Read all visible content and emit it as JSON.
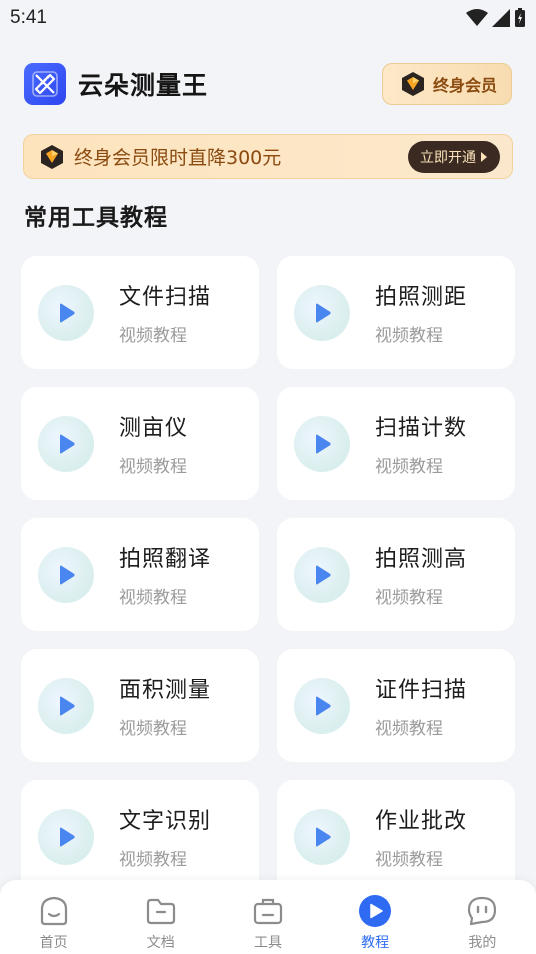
{
  "status_bar": {
    "time": "5:41"
  },
  "header": {
    "app_name": "云朵测量王",
    "vip_label": "终身会员"
  },
  "promo": {
    "text": "终身会员限时直降300元",
    "button_label": "立即开通"
  },
  "section": {
    "title": "常用工具教程"
  },
  "cards": [
    {
      "title": "文件扫描",
      "subtitle": "视频教程"
    },
    {
      "title": "拍照测距",
      "subtitle": "视频教程"
    },
    {
      "title": "测亩仪",
      "subtitle": "视频教程"
    },
    {
      "title": "扫描计数",
      "subtitle": "视频教程"
    },
    {
      "title": "拍照翻译",
      "subtitle": "视频教程"
    },
    {
      "title": "拍照测高",
      "subtitle": "视频教程"
    },
    {
      "title": "面积测量",
      "subtitle": "视频教程"
    },
    {
      "title": "证件扫描",
      "subtitle": "视频教程"
    },
    {
      "title": "文字识别",
      "subtitle": "视频教程"
    },
    {
      "title": "作业批改",
      "subtitle": "视频教程"
    }
  ],
  "nav": {
    "items": [
      {
        "label": "首页",
        "icon": "home-smile-icon"
      },
      {
        "label": "文档",
        "icon": "folder-icon"
      },
      {
        "label": "工具",
        "icon": "toolbox-icon"
      },
      {
        "label": "教程",
        "icon": "play-circle-icon",
        "active": true
      },
      {
        "label": "我的",
        "icon": "chat-face-icon"
      }
    ]
  },
  "colors": {
    "accent": "#2f6bf2",
    "vip_text": "#8a4a10",
    "background": "#f3f4f8"
  }
}
